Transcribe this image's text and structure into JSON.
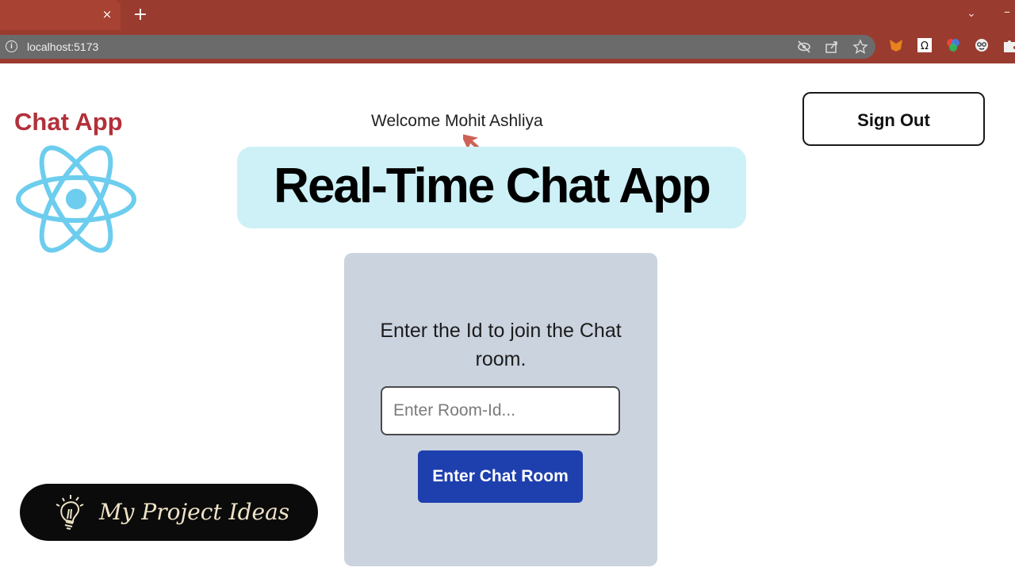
{
  "browser": {
    "tab_close": "×",
    "new_tab": "+",
    "tab_search": "⌄",
    "window_minimize": "–",
    "info": "i",
    "url": "localhost:5173",
    "omnibox_icons": [
      "eye-off-icon",
      "share-icon",
      "star-icon"
    ],
    "extension_icons": [
      "fox-extension-icon",
      "omega-extension-icon",
      "colorful-extension-icon",
      "face-extension-icon",
      "puzzle-icon"
    ]
  },
  "header": {
    "brand": "Chat App",
    "welcome": "Welcome Mohit Ashliya",
    "sign_out": "Sign Out"
  },
  "banner": {
    "title": "Real-Time Chat App"
  },
  "join_card": {
    "prompt": "Enter the Id to join the Chat room.",
    "input_placeholder": "Enter Room-Id...",
    "input_value": "",
    "button": "Enter Chat Room"
  },
  "badge": {
    "text": "My Project Ideas"
  },
  "colors": {
    "browser_chrome": "#9a3b2f",
    "brand": "#b2303a",
    "react_logo": "#6ccdee",
    "banner_bg": "#cdf1f6",
    "card_bg": "#cbd3df",
    "primary_button": "#1e3fae"
  }
}
